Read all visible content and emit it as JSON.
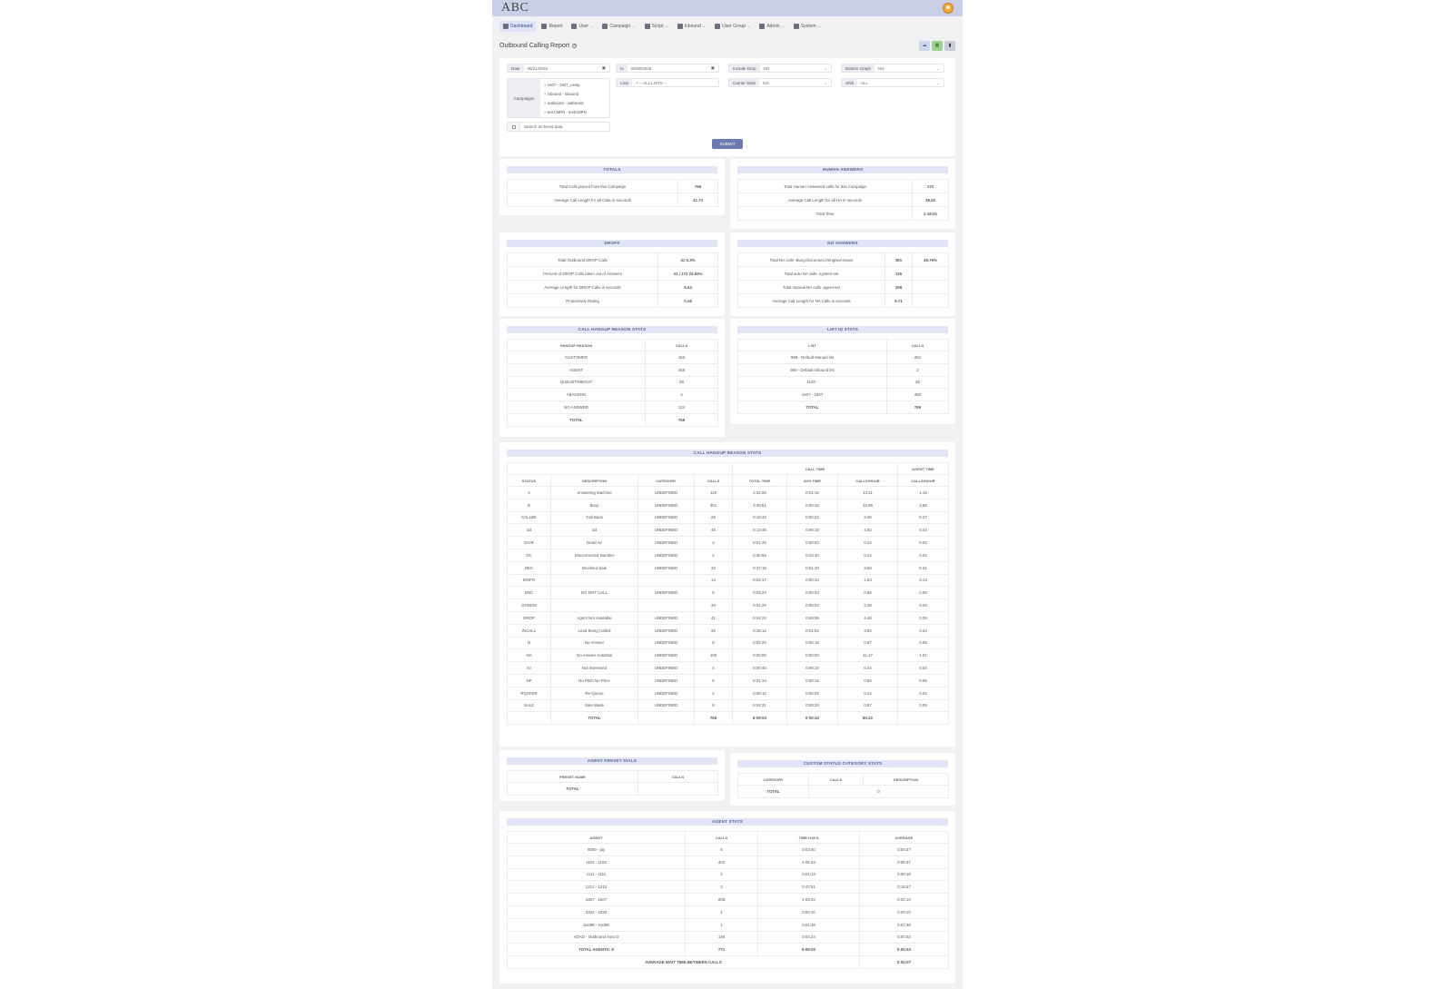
{
  "app": {
    "logo": "ABC"
  },
  "nav": [
    {
      "label": "Dashboard",
      "icon": "home-icon",
      "active": true,
      "caret": false
    },
    {
      "label": "Report",
      "icon": "report-icon",
      "caret": false
    },
    {
      "label": "User",
      "icon": "user-icon",
      "caret": true
    },
    {
      "label": "Campaign",
      "icon": "megaphone-icon",
      "caret": true
    },
    {
      "label": "Script",
      "icon": "script-icon",
      "caret": true
    },
    {
      "label": "Inbound",
      "icon": "phone-icon",
      "caret": true
    },
    {
      "label": "User Group",
      "icon": "users-icon",
      "caret": true
    },
    {
      "label": "Admin",
      "icon": "gear-icon",
      "caret": true
    },
    {
      "label": "System",
      "icon": "gear-icon",
      "caret": true
    }
  ],
  "page": {
    "title": "Outbound Calling Report"
  },
  "filters": {
    "date_label": "Date",
    "date_from": "08/21/2025",
    "to_label": "to",
    "date_to": "08/30/2025",
    "include_drop_label": "Include Drop",
    "include_drop": "NO",
    "bottom_graph_label": "Bottom Graph",
    "bottom_graph": "NO",
    "lists_label": "Lists",
    "lists": "-- ALL LISTS --",
    "carrier_stats_label": "Carrier Stats",
    "carrier_stats": "NO",
    "shift_label": "Shift",
    "shift": "ALL",
    "campaigns_label": "Campaigns",
    "campaigns": [
      "1607 - 1607_camp",
      "inbound - inbound",
      "outbound - outbound",
      "testCMPN - testCMPN"
    ],
    "archive_label": "Search archived data",
    "submit_label": "SUBMIT"
  },
  "totals": {
    "title": "TOTALS",
    "rows": [
      {
        "label": "Total Calls placed from this Campaign",
        "value": "769"
      },
      {
        "label": "Average Call Length for all Calls in seconds",
        "value": "41.73"
      }
    ]
  },
  "human": {
    "title": "HUMAN ANSWERS",
    "rows": [
      {
        "label": "Total Human Answered calls for this Campaign",
        "value": "172"
      },
      {
        "label": "Average Call Length for all HA in seconds",
        "value": "38.53"
      },
      {
        "label": "Total Time",
        "value": "1:16:01"
      }
    ]
  },
  "drops": {
    "title": "DROPS",
    "rows": [
      {
        "label": "Total Outbound DROP Calls",
        "value": "41   5.3%"
      },
      {
        "label": "Percent of DROP Calls taken out of Answers",
        "value": "41 / 172  23.84%"
      },
      {
        "label": "Average Length for DROP Calls in seconds",
        "value": "6.44"
      },
      {
        "label": "Productivity Rating",
        "value": "0.18"
      }
    ]
  },
  "no_answers": {
    "title": "NO ANSWERS",
    "rows": [
      {
        "label": "Total NA calls -Busy,Disconnect,RingNoAnswer",
        "value": "381",
        "pct": "49.75%"
      },
      {
        "label": "Total auto NA calls -system-set",
        "value": "125",
        "pct": ""
      },
      {
        "label": "Total manual NA calls -agent-set",
        "value": "256",
        "pct": ""
      },
      {
        "label": "Average Call Length for NA Calls in seconds",
        "value": "9.71",
        "pct": ""
      }
    ]
  },
  "hangup": {
    "title": "CALL HANGUP REASON STATS",
    "headers": [
      "HANGUP REASON",
      "CALLS"
    ],
    "rows": [
      [
        "CUSTOMER",
        "150"
      ],
      [
        "AGENT",
        "468"
      ],
      [
        "QUEUETIMEOUT",
        "38"
      ],
      [
        "ABANDON",
        "3"
      ],
      [
        "NO ANSWER",
        "124"
      ],
      [
        "TOTAL",
        "769"
      ]
    ]
  },
  "listid": {
    "title": "LIST ID STATS",
    "headers": [
      "LIST",
      "CALLS"
    ],
    "rows": [
      [
        "998 - Default Manual list",
        "261"
      ],
      [
        "999 - Default inbound list",
        "2"
      ],
      [
        "1103 -",
        "26"
      ],
      [
        "1607 - 1607",
        "480"
      ],
      [
        "TOTAL",
        "769"
      ]
    ]
  },
  "status": {
    "title": "CALL HANGUP REASON STATS",
    "group_call_time": "CALL TIME",
    "group_agent_time": "AGENT TIME",
    "headers": [
      "STATUS",
      "DESCRIPTION",
      "CATEGORY",
      "CALLS",
      "TOTAL TIME",
      "AVG TIME",
      "CALLS/HOUR",
      "CALLS/HOUR"
    ],
    "rows": [
      [
        "A",
        "Answering Machine",
        "UNDEFINED",
        "120",
        "2:32:28",
        "0:01:16",
        "13.11",
        "1.15"
      ],
      [
        "B",
        "Busy",
        "UNDEFINED",
        "301",
        "3:49:51",
        "0:00:46",
        "32.89",
        "2.88"
      ],
      [
        "CALLBK",
        "Call Back",
        "UNDEFINED",
        "28",
        "0:10:42",
        "0:00:23",
        "3.06",
        "0.27"
      ],
      [
        "dd",
        "dd",
        "UNDEFINED",
        "45",
        "0:13:48",
        "0:00:18",
        "4.92",
        "0.43"
      ],
      [
        "DAIR",
        "Dead Air",
        "UNDEFINED",
        "2",
        "0:01:45",
        "0:00:53",
        "0.22",
        "0.02"
      ],
      [
        "DC",
        "Disconnected Number",
        "UNDEFINED",
        "2",
        "0:46:59",
        "0:23:30",
        "0.22",
        "0.02"
      ],
      [
        "DEC",
        "Declined Sale",
        "UNDEFINED",
        "32",
        "0:37:18",
        "0:01:10",
        "3.50",
        "0.31"
      ],
      [
        "DISPO",
        "",
        "",
        "14",
        "0:02:17",
        "0:00:10",
        "1.53",
        "0.13"
      ],
      [
        "DNC",
        "DO NOT CALL",
        "UNDEFINED",
        "6",
        "0:03:24",
        "0:00:34",
        "0.66",
        "0.06"
      ],
      [
        "DONEM",
        "",
        "",
        "30",
        "0:01:29",
        "0:00:03",
        "3.28",
        "0.29"
      ],
      [
        "DROP",
        "Agent Not Available",
        "UNDEFINED",
        "41",
        "0:04:24",
        "0:00:06",
        "4.48",
        "0.39"
      ],
      [
        "INCALL",
        "Lead Being Called",
        "UNDEFINED",
        "35",
        "0:36:12",
        "0:01:02",
        "3.82",
        "0.34"
      ],
      [
        "N",
        "No Answer",
        "UNDEFINED",
        "8",
        "0:02:20",
        "0:00:18",
        "0.87",
        "0.08"
      ],
      [
        "NA",
        "No Answer AutoDial",
        "UNDEFINED",
        "105",
        "0:00:00",
        "0:00:00",
        "11.47",
        "1.01"
      ],
      [
        "NI",
        "Not Interested",
        "UNDEFINED",
        "4",
        "0:00:40",
        "0:00:10",
        "0.44",
        "0.04"
      ],
      [
        "NP",
        "No Pitch No Price",
        "UNDEFINED",
        "6",
        "0:01:14",
        "0:00:12",
        "0.66",
        "0.06"
      ],
      [
        "RQXFER",
        "Re-Queue",
        "UNDEFINED",
        "2",
        "0:00:10",
        "0:00:05",
        "0.22",
        "0.02"
      ],
      [
        "SALE",
        "Sale Made",
        "UNDEFINED",
        "8",
        "0:04:21",
        "0:00:33",
        "0.87",
        "0.08"
      ]
    ],
    "total": [
      "",
      "TOTAL",
      "",
      "769",
      "9:09:53",
      "0:00:42",
      "80.22",
      ""
    ]
  },
  "preset": {
    "title": "AGENT PRESET DIALS",
    "headers": [
      "PRESET NAME",
      "CALLS"
    ],
    "total_label": "TOTAL"
  },
  "custom": {
    "title": "CUSTOM STATUS CATEGORY STATS",
    "headers": [
      "CATEGORY",
      "CALLS",
      "DESCRIPTION"
    ],
    "total_label": "TOTAL",
    "total_calls": "0"
  },
  "agents": {
    "title": "AGENT STATS",
    "headers": [
      "AGENT",
      "CALLS",
      "TIME H:M:S",
      "AVERAGE"
    ],
    "rows": [
      [
        "0000 - jay",
        "6",
        "0:03:40",
        "0:00:37"
      ],
      [
        "1103 - 1103",
        "402",
        "4:06:23",
        "0:00:37"
      ],
      [
        "1111 - 1111",
        "4",
        "0:01:13",
        "0:00:18"
      ],
      [
        "1212 - 1212",
        "3",
        "0:47:51",
        "0:15:57"
      ],
      [
        "1607 - 1607",
        "208",
        "4:03:42",
        "0:01:10"
      ],
      [
        "3333 - 3333",
        "1",
        "0:00:10",
        "0:00:10"
      ],
      [
        "51098 - 51098",
        "1",
        "0:01:38",
        "0:01:38"
      ],
      [
        "VDAD - Outbound Auto D",
        "146",
        "0:04:24",
        "0:00:02"
      ]
    ],
    "total": [
      "TOTAL AGENTS: 8",
      "771",
      "9:09:02",
      "0:00:43"
    ],
    "wait_label": "AVERAGE WAIT TIME BETWEEN CALLS",
    "wait_value": "0:00:07"
  }
}
